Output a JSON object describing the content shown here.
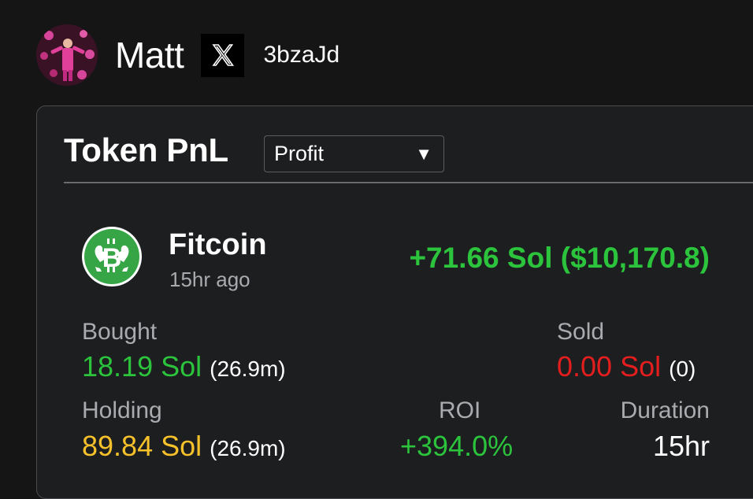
{
  "profile": {
    "name": "Matt",
    "x_icon": "x-logo-icon",
    "handle": "3bzaJd"
  },
  "card": {
    "title": "Token PnL",
    "filter": {
      "selected": "Profit",
      "arrow": "▼"
    },
    "token": {
      "icon": "bitcoin-flex-icon",
      "name": "Fitcoin",
      "time_ago": "15hr ago",
      "pnl": "+71.66 Sol ($10,170.8)"
    },
    "bought": {
      "label": "Bought",
      "amount": "18.19 Sol",
      "count": "(26.9m)"
    },
    "sold": {
      "label": "Sold",
      "amount": "0.00 Sol",
      "count": "(0)"
    },
    "holding": {
      "label": "Holding",
      "amount": "89.84 Sol",
      "count": "(26.9m)"
    },
    "roi": {
      "label": "ROI",
      "value": "+394.0%"
    },
    "duration": {
      "label": "Duration",
      "value": "15hr"
    }
  },
  "colors": {
    "background": "#151516",
    "card": "#1d1e20",
    "positive": "#2bc43c",
    "negative": "#e41e1e",
    "holding": "#f7c12b",
    "muted": "#a9abae"
  }
}
